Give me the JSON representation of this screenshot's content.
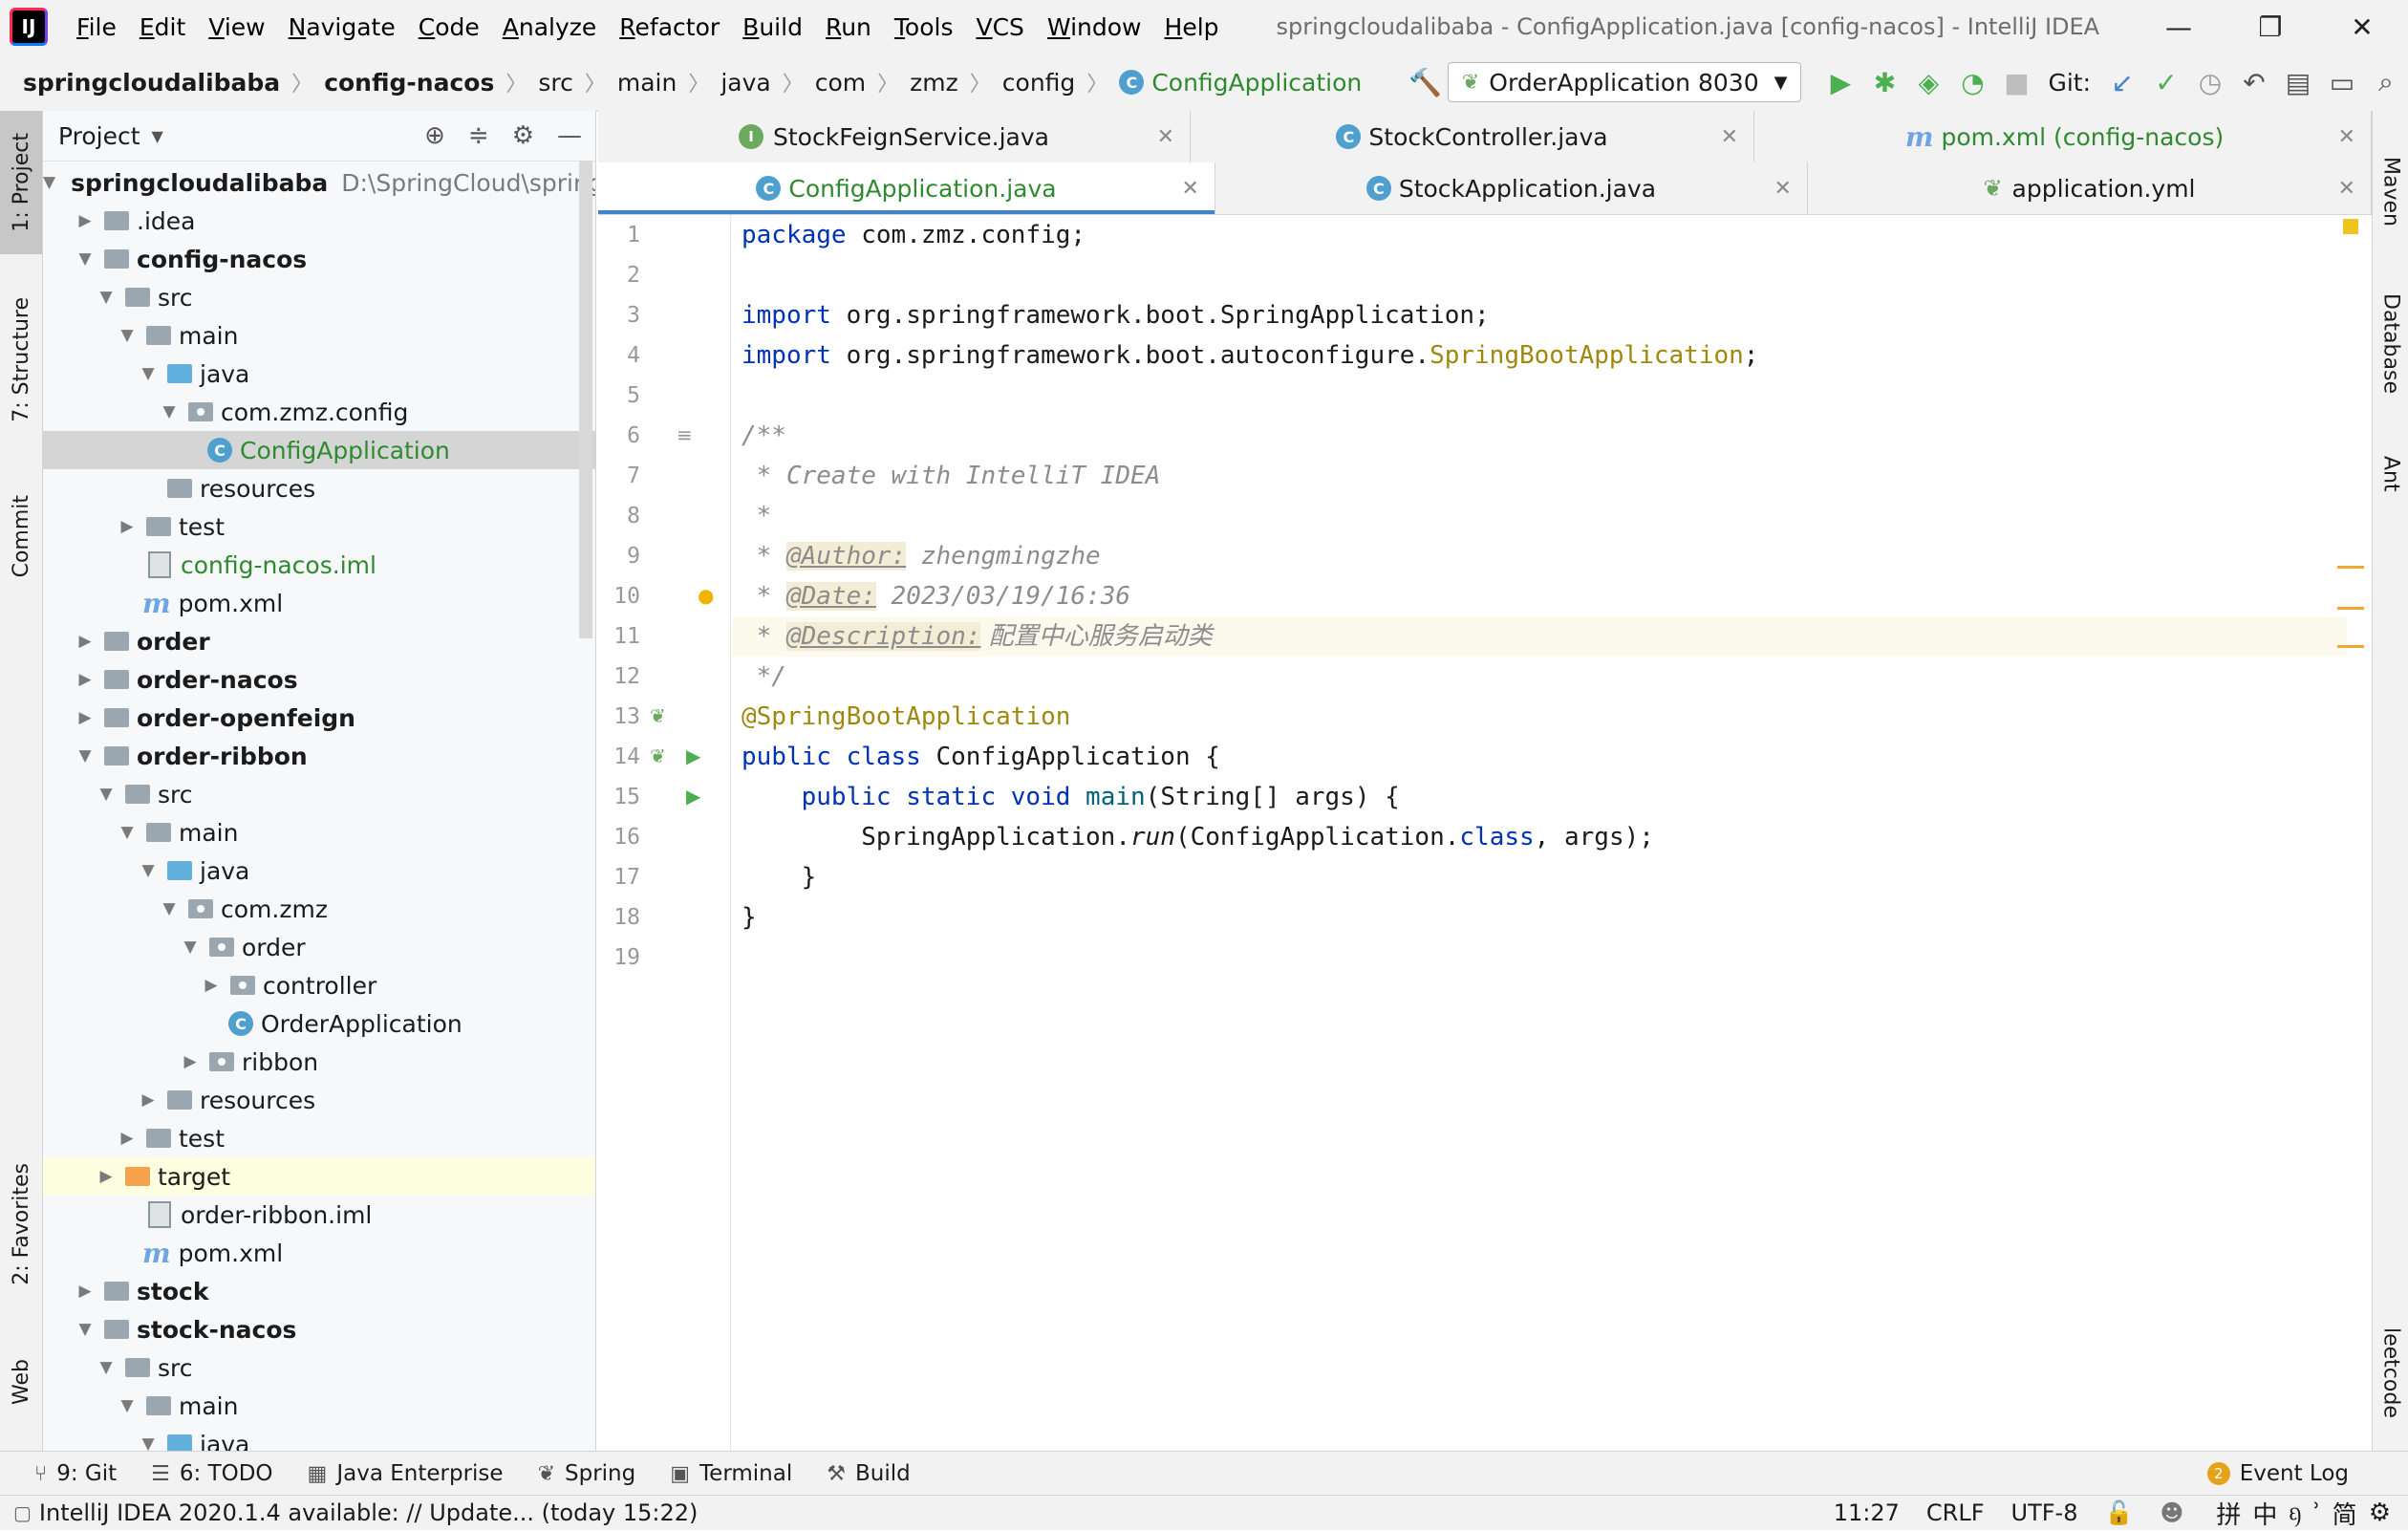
{
  "menubar": {
    "logo": "IJ",
    "items": [
      "File",
      "Edit",
      "View",
      "Navigate",
      "Code",
      "Analyze",
      "Refactor",
      "Build",
      "Run",
      "Tools",
      "VCS",
      "Window",
      "Help"
    ],
    "window_title": "springcloudalibaba - ConfigApplication.java [config-nacos] - IntelliJ IDEA",
    "controls": [
      "—",
      "❐",
      "✕"
    ]
  },
  "breadcrumb": [
    "springcloudalibaba",
    "config-nacos",
    "src",
    "main",
    "java",
    "com",
    "zmz",
    "config",
    "ConfigApplication"
  ],
  "toolbar": {
    "run_config": "OrderApplication 8030",
    "git_label": "Git:"
  },
  "left_stripe": [
    "1: Project",
    "7: Structure",
    "Commit",
    "2: Favorites",
    "Web"
  ],
  "right_stripe": [
    "Maven",
    "Database",
    "Ant",
    "leetcode"
  ],
  "project": {
    "title": "Project",
    "root_path": "D:\\SpringCloud\\spring",
    "tree": [
      {
        "label": "springcloudalibaba",
        "depth": 0,
        "arrow": "down",
        "icon": "folder",
        "bold": true
      },
      {
        "label": ".idea",
        "depth": 1,
        "arrow": "right",
        "icon": "folder"
      },
      {
        "label": "config-nacos",
        "depth": 1,
        "arrow": "down",
        "icon": "folder",
        "bold": true
      },
      {
        "label": "src",
        "depth": 2,
        "arrow": "down",
        "icon": "folder"
      },
      {
        "label": "main",
        "depth": 3,
        "arrow": "down",
        "icon": "folder"
      },
      {
        "label": "java",
        "depth": 4,
        "arrow": "down",
        "icon": "folder-blue"
      },
      {
        "label": "com.zmz.config",
        "depth": 5,
        "arrow": "down",
        "icon": "package"
      },
      {
        "label": "ConfigApplication",
        "depth": 6,
        "arrow": "",
        "icon": "class",
        "green": true,
        "selected": true
      },
      {
        "label": "resources",
        "depth": 4,
        "arrow": "",
        "icon": "folder"
      },
      {
        "label": "test",
        "depth": 3,
        "arrow": "right",
        "icon": "folder"
      },
      {
        "label": "config-nacos.iml",
        "depth": 3,
        "arrow": "",
        "icon": "file",
        "green": true
      },
      {
        "label": "pom.xml",
        "depth": 3,
        "arrow": "",
        "icon": "maven"
      },
      {
        "label": "order",
        "depth": 1,
        "arrow": "right",
        "icon": "folder",
        "bold": true
      },
      {
        "label": "order-nacos",
        "depth": 1,
        "arrow": "right",
        "icon": "folder",
        "bold": true
      },
      {
        "label": "order-openfeign",
        "depth": 1,
        "arrow": "right",
        "icon": "folder",
        "bold": true
      },
      {
        "label": "order-ribbon",
        "depth": 1,
        "arrow": "down",
        "icon": "folder",
        "bold": true
      },
      {
        "label": "src",
        "depth": 2,
        "arrow": "down",
        "icon": "folder"
      },
      {
        "label": "main",
        "depth": 3,
        "arrow": "down",
        "icon": "folder"
      },
      {
        "label": "java",
        "depth": 4,
        "arrow": "down",
        "icon": "folder-blue"
      },
      {
        "label": "com.zmz",
        "depth": 5,
        "arrow": "down",
        "icon": "package"
      },
      {
        "label": "order",
        "depth": 6,
        "arrow": "down",
        "icon": "package"
      },
      {
        "label": "controller",
        "depth": 7,
        "arrow": "right",
        "icon": "package"
      },
      {
        "label": "OrderApplication",
        "depth": 7,
        "arrow": "",
        "icon": "class"
      },
      {
        "label": "ribbon",
        "depth": 6,
        "arrow": "right",
        "icon": "package"
      },
      {
        "label": "resources",
        "depth": 4,
        "arrow": "right",
        "icon": "folder"
      },
      {
        "label": "test",
        "depth": 3,
        "arrow": "right",
        "icon": "folder"
      },
      {
        "label": "target",
        "depth": 2,
        "arrow": "right",
        "icon": "folder-orange",
        "highlight": true
      },
      {
        "label": "order-ribbon.iml",
        "depth": 3,
        "arrow": "",
        "icon": "file"
      },
      {
        "label": "pom.xml",
        "depth": 3,
        "arrow": "",
        "icon": "maven"
      },
      {
        "label": "stock",
        "depth": 1,
        "arrow": "right",
        "icon": "folder",
        "bold": true
      },
      {
        "label": "stock-nacos",
        "depth": 1,
        "arrow": "down",
        "icon": "folder",
        "bold": true
      },
      {
        "label": "src",
        "depth": 2,
        "arrow": "down",
        "icon": "folder"
      },
      {
        "label": "main",
        "depth": 3,
        "arrow": "down",
        "icon": "folder"
      },
      {
        "label": "java",
        "depth": 4,
        "arrow": "down",
        "icon": "folder-blue"
      }
    ]
  },
  "tabs_row1": [
    {
      "label": "StockFeignService.java",
      "icon": "interface"
    },
    {
      "label": "StockController.java",
      "icon": "class"
    },
    {
      "label": "pom.xml (config-nacos)",
      "icon": "maven",
      "green": true
    }
  ],
  "tabs_row2": [
    {
      "label": "ConfigApplication.java",
      "icon": "class",
      "green": true,
      "active": true
    },
    {
      "label": "StockApplication.java",
      "icon": "class"
    },
    {
      "label": "application.yml",
      "icon": "leaf"
    }
  ],
  "editor": {
    "line_numbers": [
      "1",
      "2",
      "3",
      "4",
      "5",
      "6",
      "7",
      "8",
      "9",
      "10",
      "11",
      "12",
      "13",
      "14",
      "15",
      "16",
      "17",
      "18",
      "19"
    ],
    "current_line": 11,
    "lines": [
      [
        {
          "t": "package",
          "c": "kw"
        },
        {
          "t": " com.zmz.config;"
        }
      ],
      [],
      [
        {
          "t": "import",
          "c": "kw"
        },
        {
          "t": " org.springframework.boot.SpringApplication;"
        }
      ],
      [
        {
          "t": "import",
          "c": "kw"
        },
        {
          "t": " org.springframework.boot.autoconfigure."
        },
        {
          "t": "SpringBootApplication",
          "c": "ann"
        },
        {
          "t": ";"
        }
      ],
      [],
      [
        {
          "t": "/**",
          "c": "cmt"
        }
      ],
      [
        {
          "t": " * Create with IntelliT IDEA",
          "c": "cmt"
        }
      ],
      [
        {
          "t": " *",
          "c": "cmt"
        }
      ],
      [
        {
          "t": " * ",
          "c": "cmt"
        },
        {
          "t": "@Author:",
          "c": "tag"
        },
        {
          "t": " zhengmingzhe",
          "c": "cmt"
        }
      ],
      [
        {
          "t": " * ",
          "c": "cmt"
        },
        {
          "t": "@Date:",
          "c": "tag"
        },
        {
          "t": " 2023/03/19/16:36",
          "c": "cmt"
        }
      ],
      [
        {
          "t": " * ",
          "c": "cmt"
        },
        {
          "t": "@Description:",
          "c": "tag"
        },
        {
          "t": " 配置中心服务启动类",
          "c": "cmt cjk"
        }
      ],
      [
        {
          "t": " */",
          "c": "cmt"
        }
      ],
      [
        {
          "t": "@SpringBootApplication",
          "c": "ann"
        }
      ],
      [
        {
          "t": "public class",
          "c": "kw"
        },
        {
          "t": " ConfigApplication {"
        }
      ],
      [
        {
          "t": "    "
        },
        {
          "t": "public static void",
          "c": "kw"
        },
        {
          "t": " "
        },
        {
          "t": "main",
          "c": "fn"
        },
        {
          "t": "(String[] args) {"
        }
      ],
      [
        {
          "t": "        SpringApplication."
        },
        {
          "t": "run",
          "c": "it"
        },
        {
          "t": "(ConfigApplication."
        },
        {
          "t": "class",
          "c": "kw"
        },
        {
          "t": ", args);"
        }
      ],
      [
        {
          "t": "    }"
        }
      ],
      [
        {
          "t": "}"
        }
      ],
      []
    ]
  },
  "bottom_tools": [
    {
      "label": "9: Git",
      "icon": "⑂"
    },
    {
      "label": "6: TODO",
      "icon": "☰"
    },
    {
      "label": "Java Enterprise",
      "icon": "▦"
    },
    {
      "label": "Spring",
      "icon": "❦"
    },
    {
      "label": "Terminal",
      "icon": "▣"
    },
    {
      "label": "Build",
      "icon": "⚒"
    }
  ],
  "event_log": {
    "count": "2",
    "label": "Event Log"
  },
  "status": {
    "message": "IntelliJ IDEA 2020.1.4 available: // Update... (today 15:22)",
    "position": "11:27",
    "line_sep": "CRLF",
    "encoding": "UTF-8",
    "ime": [
      "拼",
      "中",
      "ᦏ",
      "ʾ",
      "简",
      "⚙"
    ]
  },
  "colors": {
    "accent": "#4083c9",
    "keyword": "#0033b3",
    "annotation": "#9e880d",
    "comment": "#8c8c8c",
    "green": "#2f8a2f"
  }
}
